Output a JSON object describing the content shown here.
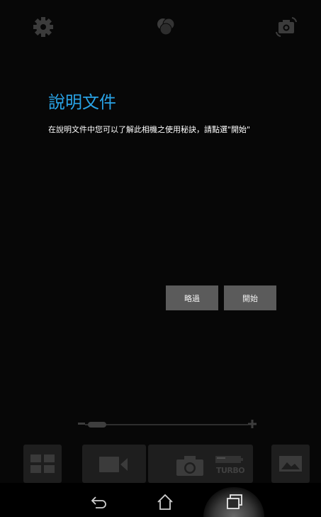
{
  "help": {
    "title": "說明文件",
    "description": "在說明文件中您可以了解此相機之使用秘訣，請點選\"開始\""
  },
  "buttons": {
    "skip_label": "略過",
    "start_label": "開始"
  },
  "camera": {
    "turbo_label": "TURBO"
  },
  "colors": {
    "accent": "#29a3e6",
    "button_bg": "#5b5b5b",
    "background": "#070707"
  }
}
